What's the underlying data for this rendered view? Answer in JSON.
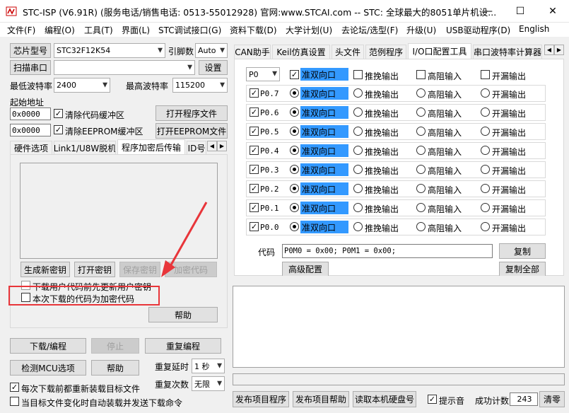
{
  "title": "STC-ISP (V6.91R) (服务电话/销售电话: 0513-55012928) 官网:www.STCAI.com  -- STC: 全球最大的8051单片机设...",
  "window_controls": {
    "minimize": "—",
    "maximize": "☐",
    "close": "✕"
  },
  "menu": [
    "文件(F)",
    "编程(O)",
    "工具(T)",
    "界面(L)",
    "STC调试接口(G)",
    "资料下载(D)",
    "大学计划(U)",
    "去论坛/选型(F)",
    "升级(U)",
    "USB驱动程序(D)",
    "English"
  ],
  "left": {
    "chip_type_btn": "芯片型号",
    "chip_type_value": "STC32F12K54",
    "pin_count_label": "引脚数",
    "pin_count_value": "Auto",
    "scan_port_btn": "扫描串口",
    "port_value": "",
    "settings_btn": "设置",
    "min_baud_label": "最低波特率",
    "min_baud_value": "2400",
    "max_baud_label": "最高波特率",
    "max_baud_value": "115200",
    "start_addr_label": "起始地址",
    "addr1": "0x0000",
    "clear_code_label": "清除代码缓冲区",
    "open_prog_btn": "打开程序文件",
    "addr2": "0x0000",
    "clear_eeprom_label": "清除EEPROM缓冲区",
    "open_eeprom_btn": "打开EEPROM文件",
    "tabs": [
      "硬件选项",
      "Link1/U8W脱机",
      "程序加密后传输",
      "ID号"
    ],
    "gen_key_btn": "生成新密钥",
    "open_key_btn": "打开密钥",
    "save_key_btn": "保存密钥",
    "encrypt_btn": "加密代码",
    "update_key_label": "下载用户代码前先更新用户密钥",
    "encrypted_download_label": "本次下载的代码为加密代码",
    "help_btn": "帮助",
    "download_btn": "下载/编程",
    "stop_btn": "停止",
    "reprogram_btn": "重复编程",
    "check_mcu_btn": "检测MCU选项",
    "help2_btn": "帮助",
    "repeat_delay_label": "重复延时",
    "repeat_delay_value": "1 秒",
    "repeat_count_label": "重复次数",
    "repeat_count_value": "无限",
    "reload_label": "每次下载前都重新装载目标文件",
    "auto_load_label": "当目标文件变化时自动装载并发送下载命令"
  },
  "right": {
    "tabs": [
      "CAN助手",
      "Keil仿真设置",
      "头文件",
      "范例程序",
      "I/O口配置工具",
      "串口波特率计算器"
    ],
    "port_select": "P0",
    "header_opts": [
      "准双向口",
      "推挽输出",
      "高阻输入",
      "开漏输出"
    ],
    "pins": [
      {
        "name": "P0.7",
        "mode": 0
      },
      {
        "name": "P0.6",
        "mode": 0
      },
      {
        "name": "P0.5",
        "mode": 0
      },
      {
        "name": "P0.4",
        "mode": 0
      },
      {
        "name": "P0.3",
        "mode": 0
      },
      {
        "name": "P0.2",
        "mode": 0
      },
      {
        "name": "P0.1",
        "mode": 0
      },
      {
        "name": "P0.0",
        "mode": 0
      }
    ],
    "code_label": "代码",
    "code_value": "P0M0 = 0x00; P0M1 = 0x00;",
    "copy_btn": "复制",
    "advanced_btn": "高级配置",
    "copy_all_btn": "复制全部"
  },
  "bottom": {
    "publish_btn": "发布项目程序",
    "publish_help_btn": "发布项目帮助",
    "read_disk_btn": "读取本机硬盘号",
    "sound_label": "提示音",
    "success_label": "成功计数",
    "success_value": "243",
    "clear_btn": "清零"
  }
}
